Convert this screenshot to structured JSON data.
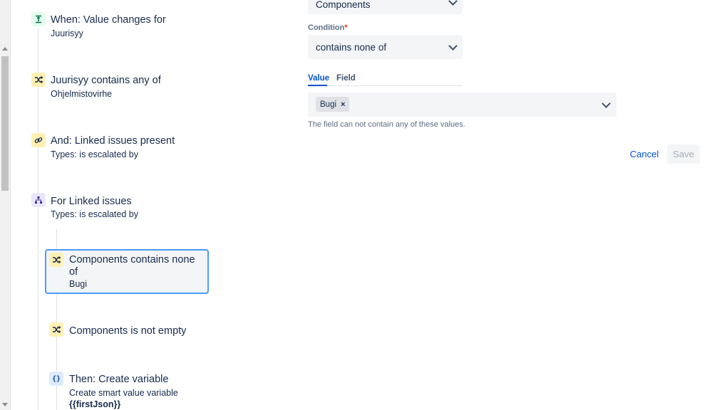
{
  "steps": {
    "trigger": {
      "title": "When: Value changes for",
      "sub": "Juurisyy",
      "icon": "field-change-icon"
    },
    "cond1": {
      "title": "Juurisyy contains any of",
      "sub": "Ohjelmistovirhe",
      "icon": "shuffle-icon"
    },
    "cond2": {
      "title": "And: Linked issues present",
      "sub": "Types: is escalated by",
      "icon": "link-icon"
    },
    "branch": {
      "title": "For Linked issues",
      "sub": "Types: is escalated by",
      "icon": "hierarchy-icon"
    },
    "nested1": {
      "title_line1": "Components contains none",
      "title_line2": "of",
      "sub": "Bugi",
      "icon": "shuffle-icon"
    },
    "nested2": {
      "title": "Components is not empty",
      "icon": "shuffle-icon"
    },
    "nested3": {
      "title": "Then: Create variable",
      "sub": "Create smart value variable",
      "sub2": "{{firstJson}}",
      "icon_glyph": "{}",
      "icon": "braces-icon"
    }
  },
  "form": {
    "field_value": "Components",
    "condition_label": "Condition",
    "condition_required": "*",
    "condition_value": "contains none of",
    "tabs": {
      "value": "Value",
      "field": "Field"
    },
    "tag_value": "Bugi",
    "tag_remove": "×",
    "helper": "The field can not contain any of these values.",
    "cancel": "Cancel",
    "save": "Save"
  },
  "colors": {
    "accent": "#0052cc",
    "selected_border": "#4c9aff"
  }
}
